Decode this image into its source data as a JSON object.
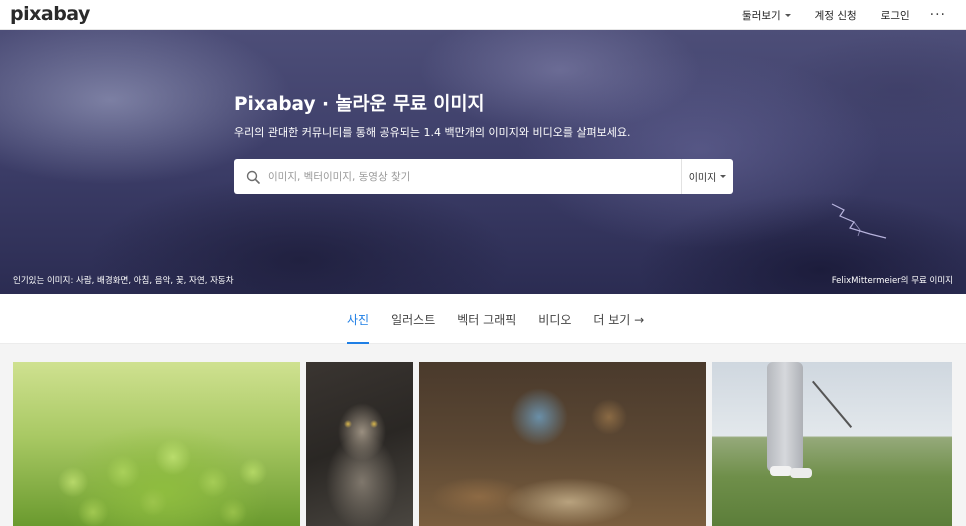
{
  "header": {
    "logo": "pixabay",
    "nav": {
      "explore": "둘러보기",
      "signup": "계정 신청",
      "login": "로그인",
      "more": "···"
    }
  },
  "hero": {
    "title": "Pixabay · 놀라운 무료 이미지",
    "subtitle": "우리의 관대한 커뮤니티를 통해 공유되는 1.4 백만개의 이미지와 비디오를 살펴보세요.",
    "search": {
      "placeholder": "이미지, 벡터이미지, 동영상 찾기",
      "type_label": "이미지"
    },
    "popular": "인기있는 이미지: 사람, 배경화면, 아침, 음악, 꽃, 자연, 자동차",
    "credit": "FelixMittermeier의 무료 이미지"
  },
  "tabs": [
    {
      "label": "사진"
    },
    {
      "label": "일러스트"
    },
    {
      "label": "벡터 그래픽"
    },
    {
      "label": "비디오"
    },
    {
      "label": "더 보기 →"
    }
  ],
  "colors": {
    "accent": "#1f7fe5",
    "hero_bg": "#3e3f6a"
  },
  "icons": {
    "search": "search-icon",
    "caret": "chevron-down-icon",
    "more": "more-horizontal-icon"
  }
}
